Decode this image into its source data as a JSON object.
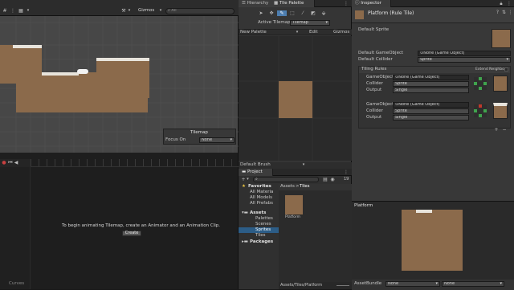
{
  "scene": {
    "toolbar_gizmos": "Gizmos",
    "toolbar_search": "All",
    "tilemap_overlay": {
      "title": "Tilemap",
      "focus_label": "Focus On",
      "focus_value": "None"
    }
  },
  "hierarchy": {
    "tab": "Hierarchy"
  },
  "tile_palette": {
    "tab": "Tile Palette",
    "active_tilemap_label": "Active Tilemap",
    "active_tilemap_value": "Tilemap",
    "palette_name": "New Palette",
    "edit_label": "Edit",
    "gizmos_label": "Gizmos",
    "brush": "Default Brush"
  },
  "animation": {
    "message": "To begin animating Tilemap, create an Animator and an Animation Clip.",
    "create_label": "Create",
    "curves_label": "Curves"
  },
  "project": {
    "tab": "Project",
    "badge": "19",
    "favorites": "Favorites",
    "favorite_items": [
      "All Materia",
      "All Models",
      "All Prefabs"
    ],
    "assets": "Assets",
    "asset_folders": [
      "Palettes",
      "Scenes",
      "Sprites",
      "Tiles"
    ],
    "packages": "Packages",
    "breadcrumb_root": "Assets",
    "breadcrumb_sep": ">",
    "breadcrumb_current": "Tiles",
    "asset_item": "Platform",
    "path": "Assets/Tiles/Platform"
  },
  "inspector": {
    "tab": "Inspector",
    "title": "Platform (Rule Tile)",
    "default_sprite": "Default Sprite",
    "default_gameobject": "Default GameObject",
    "default_gameobject_value": "None (Game Object)",
    "default_collider": "Default Collider",
    "default_collider_value": "Sprite",
    "tiling_rules": "Tiling Rules",
    "extend_neighbor": "Extend Neighbor",
    "rules": [
      {
        "go_label": "GameObject",
        "go_value": "None (Game Object)",
        "collider_label": "Collider",
        "collider_value": "Sprite",
        "output_label": "Output",
        "output_value": "Single"
      },
      {
        "go_label": "GameObject",
        "go_value": "None (Game Object)",
        "collider_label": "Collider",
        "collider_value": "Sprite",
        "output_label": "Output",
        "output_value": "Single"
      }
    ],
    "preview_title": "Platform",
    "assetbundle_label": "AssetBundle",
    "assetbundle_value": "None",
    "assetbundle_variant": "None"
  },
  "colors": {
    "dirt": "#8b6a4b",
    "snow": "#e8e4dc",
    "accent": "#2c5d87"
  }
}
